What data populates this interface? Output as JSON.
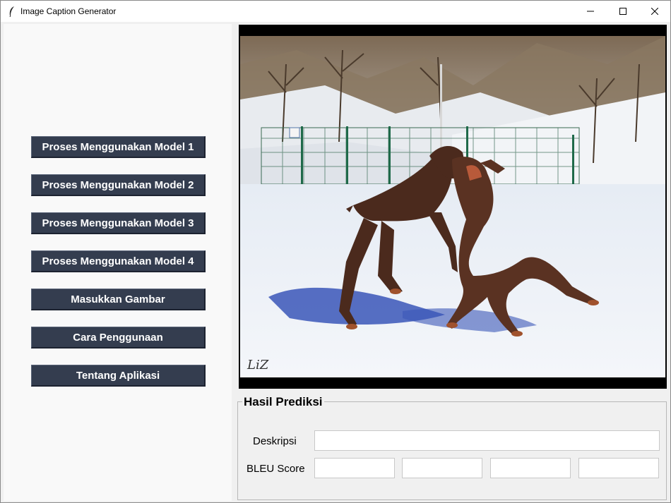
{
  "window": {
    "title": "Image Caption Generator"
  },
  "sidebar": {
    "buttons": [
      {
        "label": "Proses Menggunakan Model 1"
      },
      {
        "label": "Proses Menggunakan Model 2"
      },
      {
        "label": "Proses Menggunakan Model 3"
      },
      {
        "label": "Proses Menggunakan Model 4"
      },
      {
        "label": "Masukkan Gambar"
      },
      {
        "label": "Cara Penggunaan"
      },
      {
        "label": "Tentang Aplikasi"
      }
    ],
    "button_color": "#343d4f"
  },
  "image_preview": {
    "description": "Two Doberman dogs playing in the snow in front of a fence",
    "watermark": "LiZ"
  },
  "results": {
    "title": "Hasil Prediksi",
    "description_label": "Deskripsi",
    "description_value": "",
    "bleu_label": "BLEU Score",
    "bleu_values": [
      "",
      "",
      "",
      ""
    ]
  }
}
